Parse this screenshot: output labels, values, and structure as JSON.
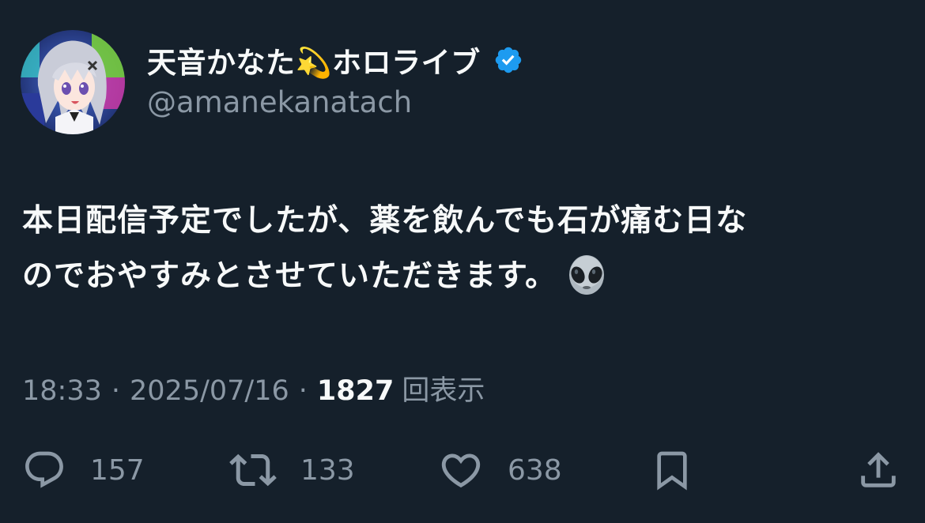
{
  "author": {
    "display_name": "天音かなた",
    "display_name_emoji": "💫",
    "display_name_suffix": "ホロライブ",
    "handle": "@amanekanatach",
    "verified": true
  },
  "tweet": {
    "lines": [
      "本日配信予定でしたが、薬を飲んでも石が痛む日な",
      "のでおやすみとさせていただきます。"
    ],
    "trailing_emoji": "alien-icon"
  },
  "meta": {
    "time": "18:33",
    "separator": "·",
    "date": "2025/07/16",
    "views_count": "1827",
    "views_label": "回表示"
  },
  "actions": {
    "replies": "157",
    "retweets": "133",
    "likes": "638"
  },
  "colors": {
    "background": "#15202b",
    "primary_text": "#f7f9f9",
    "secondary_text": "#8b98a5",
    "verified_badge": "#1d9bf0"
  }
}
